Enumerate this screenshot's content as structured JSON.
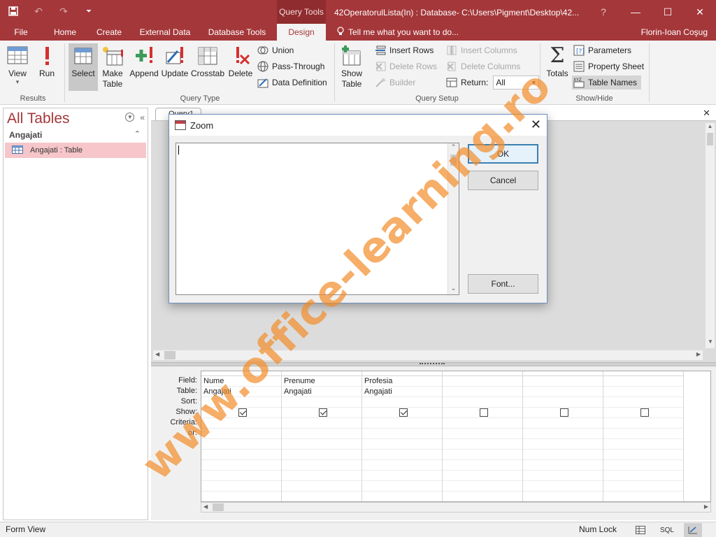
{
  "titlebar": {
    "context_tab": "Query Tools",
    "window_title": "42OperatorulLista(In) : Database- C:\\Users\\Pigment\\Desktop\\42...",
    "help": "?",
    "minimize": "—",
    "maximize": "☐",
    "close": "✕"
  },
  "qat": {
    "save": "save-icon",
    "undo": "↶",
    "redo": "↷",
    "customize": "⏷"
  },
  "tabs": [
    {
      "label": "File"
    },
    {
      "label": "Home"
    },
    {
      "label": "Create"
    },
    {
      "label": "External Data"
    },
    {
      "label": "Database Tools"
    },
    {
      "label": "Design"
    }
  ],
  "tell_me": "Tell me what you want to do...",
  "user_name": "Florin-Ioan Coşug",
  "ribbon": {
    "results": {
      "label": "Results",
      "view": "View",
      "run": "Run"
    },
    "query_type": {
      "label": "Query Type",
      "select": "Select",
      "make_table": "Make Table",
      "append": "Append",
      "update": "Update",
      "crosstab": "Crosstab",
      "delete": "Delete",
      "union": "Union",
      "pass_through": "Pass-Through",
      "data_definition": "Data Definition"
    },
    "query_setup": {
      "label": "Query Setup",
      "show_table": "Show Table",
      "insert_rows": "Insert Rows",
      "delete_rows": "Delete Rows",
      "builder": "Builder",
      "insert_columns": "Insert Columns",
      "delete_columns": "Delete Columns",
      "return_label": "Return:",
      "return_value": "All"
    },
    "show_hide": {
      "label": "Show/Hide",
      "totals": "Totals",
      "parameters": "Parameters",
      "property_sheet": "Property Sheet",
      "table_names": "Table Names"
    }
  },
  "nav": {
    "title": "All Tables",
    "group": "Angajati",
    "item": "Angajati : Table"
  },
  "query": {
    "tab_label": "Query1",
    "close": "✕"
  },
  "grid": {
    "row_labels": [
      "Field:",
      "Table:",
      "Sort:",
      "Show:",
      "Criteria:",
      "or:"
    ],
    "columns": [
      {
        "field": "Nume",
        "table": "Angajati",
        "show": true
      },
      {
        "field": "Prenume",
        "table": "Angajati",
        "show": true
      },
      {
        "field": "Profesia",
        "table": "Angajati",
        "show": true
      },
      {
        "field": "",
        "table": "",
        "show": false
      },
      {
        "field": "",
        "table": "",
        "show": false
      },
      {
        "field": "",
        "table": "",
        "show": false
      }
    ]
  },
  "dialog": {
    "title": "Zoom",
    "text_value": "",
    "ok": "OK",
    "cancel": "Cancel",
    "font": "Font..."
  },
  "status": {
    "left": "Form View",
    "num_lock": "Num Lock",
    "sql": "SQL"
  },
  "watermark": "www.office-learning.ro",
  "colors": {
    "accent": "#a4373a",
    "watermark": "#f28c28",
    "selected_nav": "#f6c6ca"
  }
}
